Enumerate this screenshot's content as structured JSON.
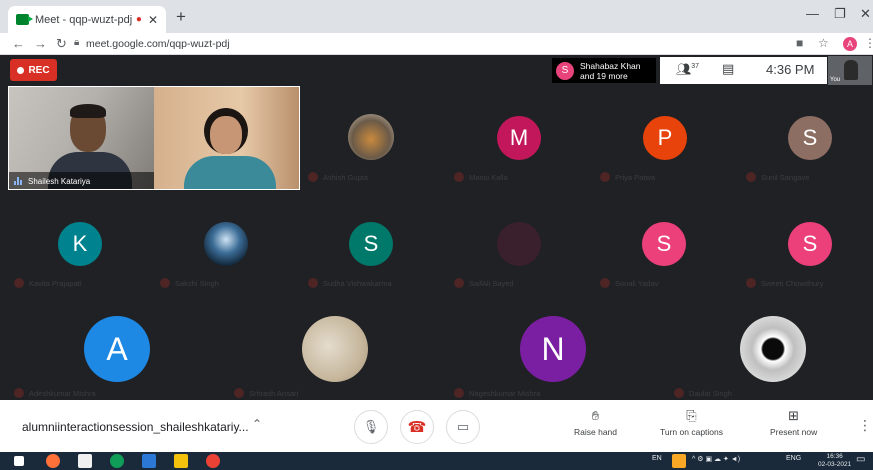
{
  "browser": {
    "tab_title": "Meet - qqp-wuzt-pdj",
    "tab_recording_icon": "record-dot-icon",
    "url": "meet.google.com/qqp-wuzt-pdj",
    "profile_initial": "A"
  },
  "meet": {
    "rec_label": "REC",
    "presenter": {
      "initial": "S",
      "line1": "Shahabaz Khan",
      "line2": "and 19 more"
    },
    "participant_count": "37",
    "time": "4:36 PM",
    "self_label": "You",
    "meeting_name": "alumniinteractionsession_shaileshkatariy...",
    "controls": {
      "raise_hand": "Raise hand",
      "captions": "Turn on captions",
      "present": "Present now"
    }
  },
  "colors": {
    "m": "#c2185b",
    "p": "#e8430b",
    "s_brown": "#8d6e63",
    "k": "#00838f",
    "s_green": "#00796b",
    "s_pink": "#ec407a",
    "a": "#1e88e5",
    "n": "#7b1fa2",
    "rec": "#d93025"
  },
  "video_tiles": [
    {
      "name": "Shailesh Katariya"
    },
    {
      "name": ""
    }
  ],
  "participants": [
    {
      "name": "Ashish Gupta",
      "initial": "",
      "photo": "photo-ashish"
    },
    {
      "name": "Mansi Kalla",
      "initial": "M",
      "color": "#c2185b"
    },
    {
      "name": "Priya Patwa",
      "initial": "P",
      "color": "#e8430b"
    },
    {
      "name": "Sunil Sangave",
      "initial": "S",
      "color": "#8d6e63"
    },
    {
      "name": "Kavita Prajapati",
      "initial": "K",
      "color": "#00838f"
    },
    {
      "name": "Sakshi Singh",
      "initial": "",
      "photo": "photo-sakshi"
    },
    {
      "name": "Sudha Vishwakarma",
      "initial": "S",
      "color": "#00796b"
    },
    {
      "name": "SaifAli Sayed",
      "initial": "",
      "photo": "photo-saifali"
    },
    {
      "name": "Sonali Yadav",
      "initial": "S",
      "color": "#ec407a"
    },
    {
      "name": "Sweeti Chowdhury",
      "initial": "S",
      "color": "#ec407a"
    },
    {
      "name": "Adeshkumar Mishra",
      "initial": "A",
      "color": "#1e88e5"
    },
    {
      "name": "Srhrash Ansari",
      "initial": "",
      "photo": "photo-srhrash"
    },
    {
      "name": "Nageshkumar Mishra",
      "initial": "N",
      "color": "#7b1fa2"
    },
    {
      "name": "Daulat Singh",
      "initial": "",
      "photo": "photo-daulat"
    }
  ],
  "taskbar": {
    "lang1": "EN",
    "lang2": "ENG",
    "clock_time": "16:36",
    "clock_date": "02-03-2021"
  }
}
